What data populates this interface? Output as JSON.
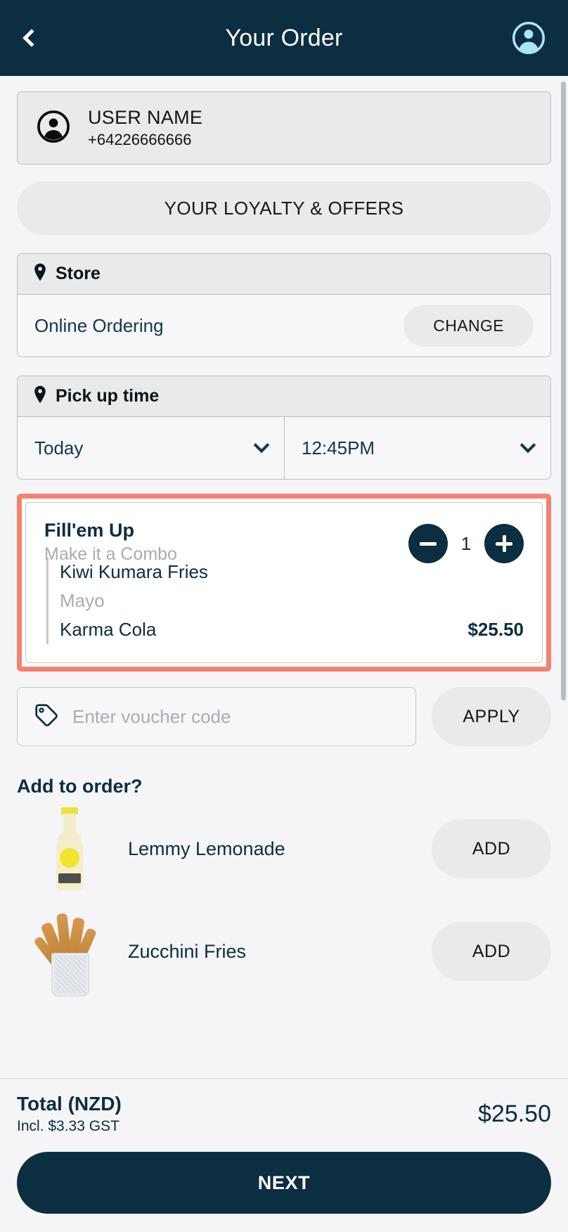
{
  "header": {
    "title": "Your Order",
    "back_icon": "chevron-left-icon",
    "account_icon": "account-circle-icon"
  },
  "user": {
    "name": "USER NAME",
    "phone": "+64226666666",
    "avatar_icon": "account-circle-icon"
  },
  "loyalty": {
    "label": "YOUR LOYALTY & OFFERS"
  },
  "store": {
    "section_label": "Store",
    "pin_icon": "location-pin-icon",
    "name": "Online Ordering",
    "change_label": "CHANGE"
  },
  "pickup": {
    "section_label": "Pick up time",
    "pin_icon": "location-pin-icon",
    "day": "Today",
    "time": "12:45PM",
    "chevron_icon": "chevron-down-icon"
  },
  "order_item": {
    "name": "Fill'em Up",
    "subtitle": "Make it a Combo",
    "quantity": "1",
    "minus_icon": "minus-icon",
    "plus_icon": "plus-icon",
    "price": "$25.50",
    "components": [
      {
        "label": "Kiwi Kumara Fries",
        "muted": false
      },
      {
        "label": "Mayo",
        "muted": true
      },
      {
        "label": "Karma Cola",
        "muted": false
      }
    ],
    "highlight_color": "#f3836f"
  },
  "voucher": {
    "tag_icon": "tag-icon",
    "value": "",
    "placeholder": "Enter voucher code",
    "apply_label": "APPLY"
  },
  "add_to_order": {
    "title": "Add to order?",
    "products": [
      {
        "name": "Lemmy Lemonade",
        "add_label": "ADD",
        "image": "lemonade-bottle"
      },
      {
        "name": "Zucchini Fries",
        "add_label": "ADD",
        "image": "fries-basket"
      }
    ]
  },
  "totals": {
    "label": "Total (NZD)",
    "gst": "Incl. $3.33 GST",
    "amount": "$25.50"
  },
  "next": {
    "label": "NEXT"
  },
  "colors": {
    "brand_navy": "#0b2e41",
    "accent_light_blue": "#a9e4f7",
    "highlight": "#f3836f",
    "page_bg": "#f5f5f7"
  }
}
